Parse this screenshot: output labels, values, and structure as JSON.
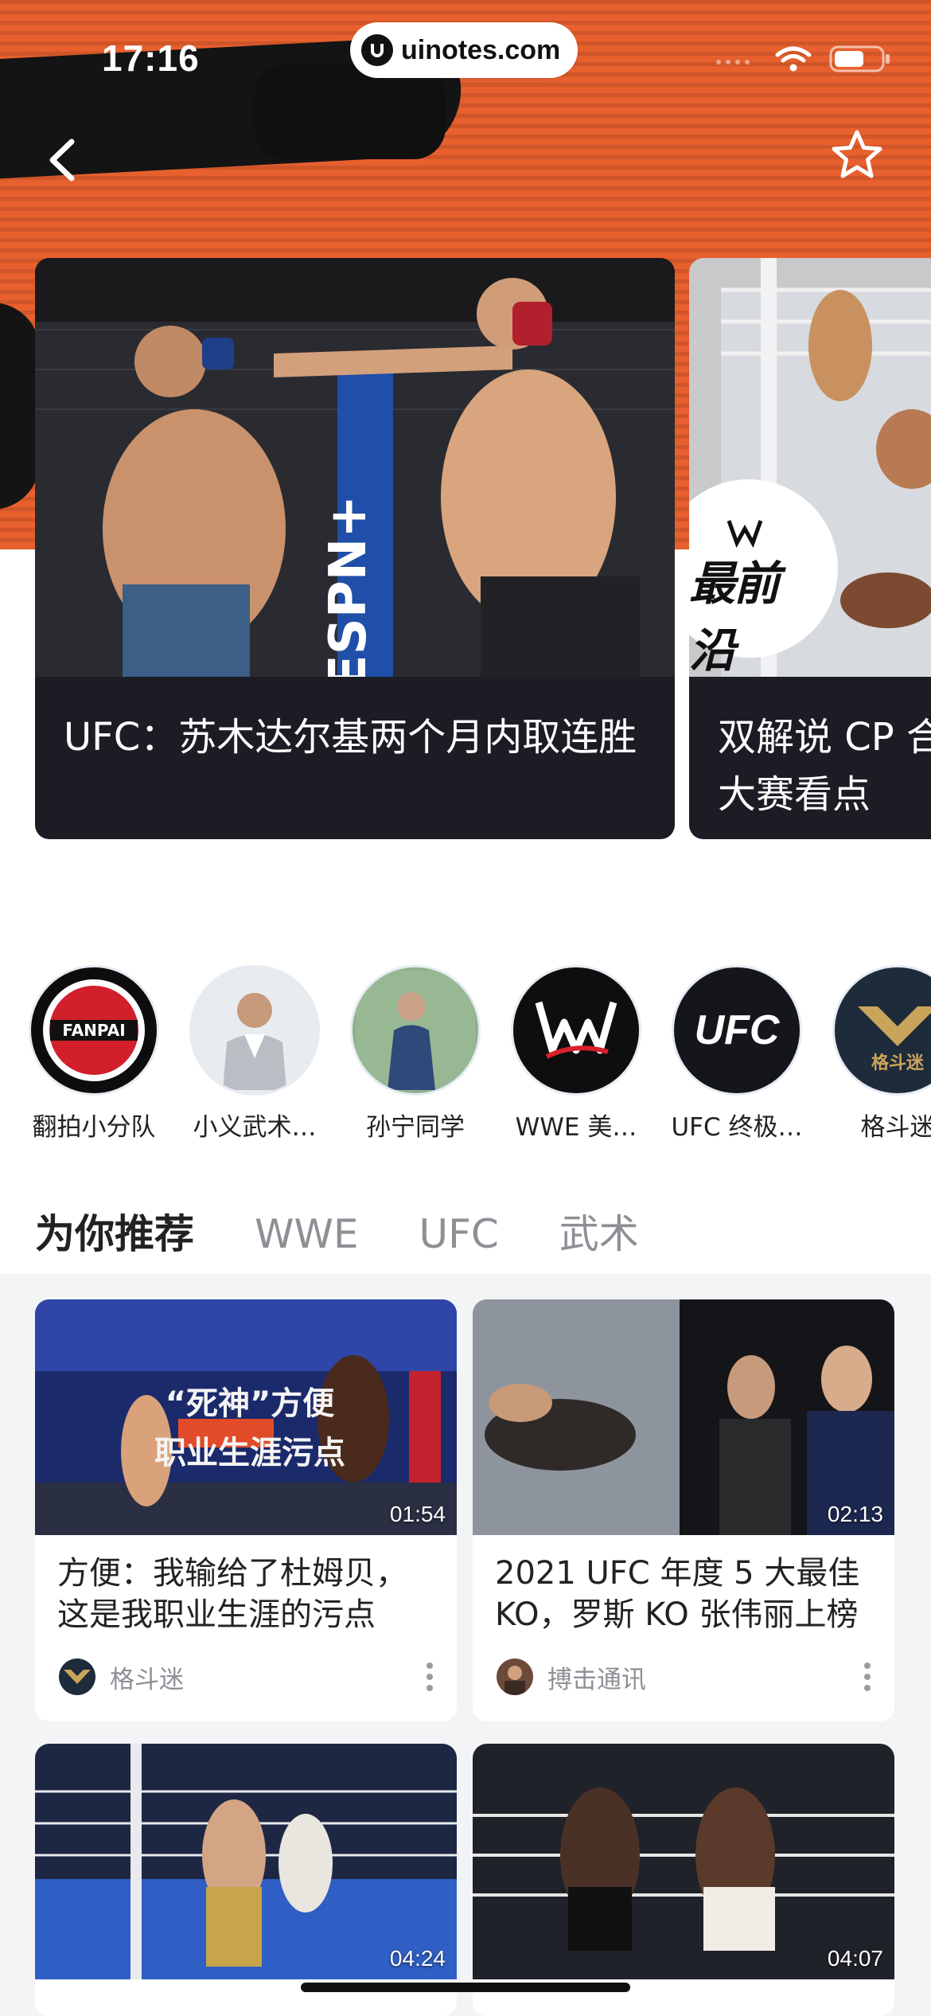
{
  "status_bar": {
    "time": "17:16",
    "url": "uinotes.com"
  },
  "nav": {
    "back_icon": "chevron-left-icon",
    "favorite_icon": "star-outline-icon"
  },
  "hero": [
    {
      "title": "UFC：苏木达尔基两个月内取连胜"
    },
    {
      "title": "双解说 CP 合大赛看点",
      "badge": "最前沿"
    }
  ],
  "creators": [
    {
      "name": "翻拍小分队",
      "avatar_color": "#c8102e"
    },
    {
      "name": "小义武术…",
      "avatar_color": "#9aa4ad"
    },
    {
      "name": "孙宁同学",
      "avatar_color": "#6e8f6a"
    },
    {
      "name": "WWE 美…",
      "avatar_color": "#0e0e0e",
      "avatar_text": "W"
    },
    {
      "name": "UFC 终极…",
      "avatar_color": "#14161b",
      "avatar_text": "UFC"
    },
    {
      "name": "格斗迷",
      "avatar_color": "#1e2b3a",
      "avatar_text": "格斗迷"
    }
  ],
  "tabs": [
    {
      "label": "为你推荐",
      "active": true
    },
    {
      "label": "WWE",
      "active": false
    },
    {
      "label": "UFC",
      "active": false
    },
    {
      "label": "武术",
      "active": false
    }
  ],
  "videos": [
    {
      "title": "方便：我输给了杜姆贝，这是我职业生涯的污点",
      "duration": "01:54",
      "author": "格斗迷",
      "overlay_line1": "“死神”方便",
      "overlay_line2": "职业生涯污点"
    },
    {
      "title": "2021 UFC 年度 5 大最佳 KO，罗斯 KO 张伟丽上榜",
      "duration": "02:13",
      "author": "搏击通讯"
    },
    {
      "title": "",
      "duration": "04:24"
    },
    {
      "title": "",
      "duration": "04:07"
    }
  ],
  "colors": {
    "banner_orange": "#e8602e",
    "card_dark": "#1c1d24",
    "feed_bg": "#f3f4f6"
  }
}
